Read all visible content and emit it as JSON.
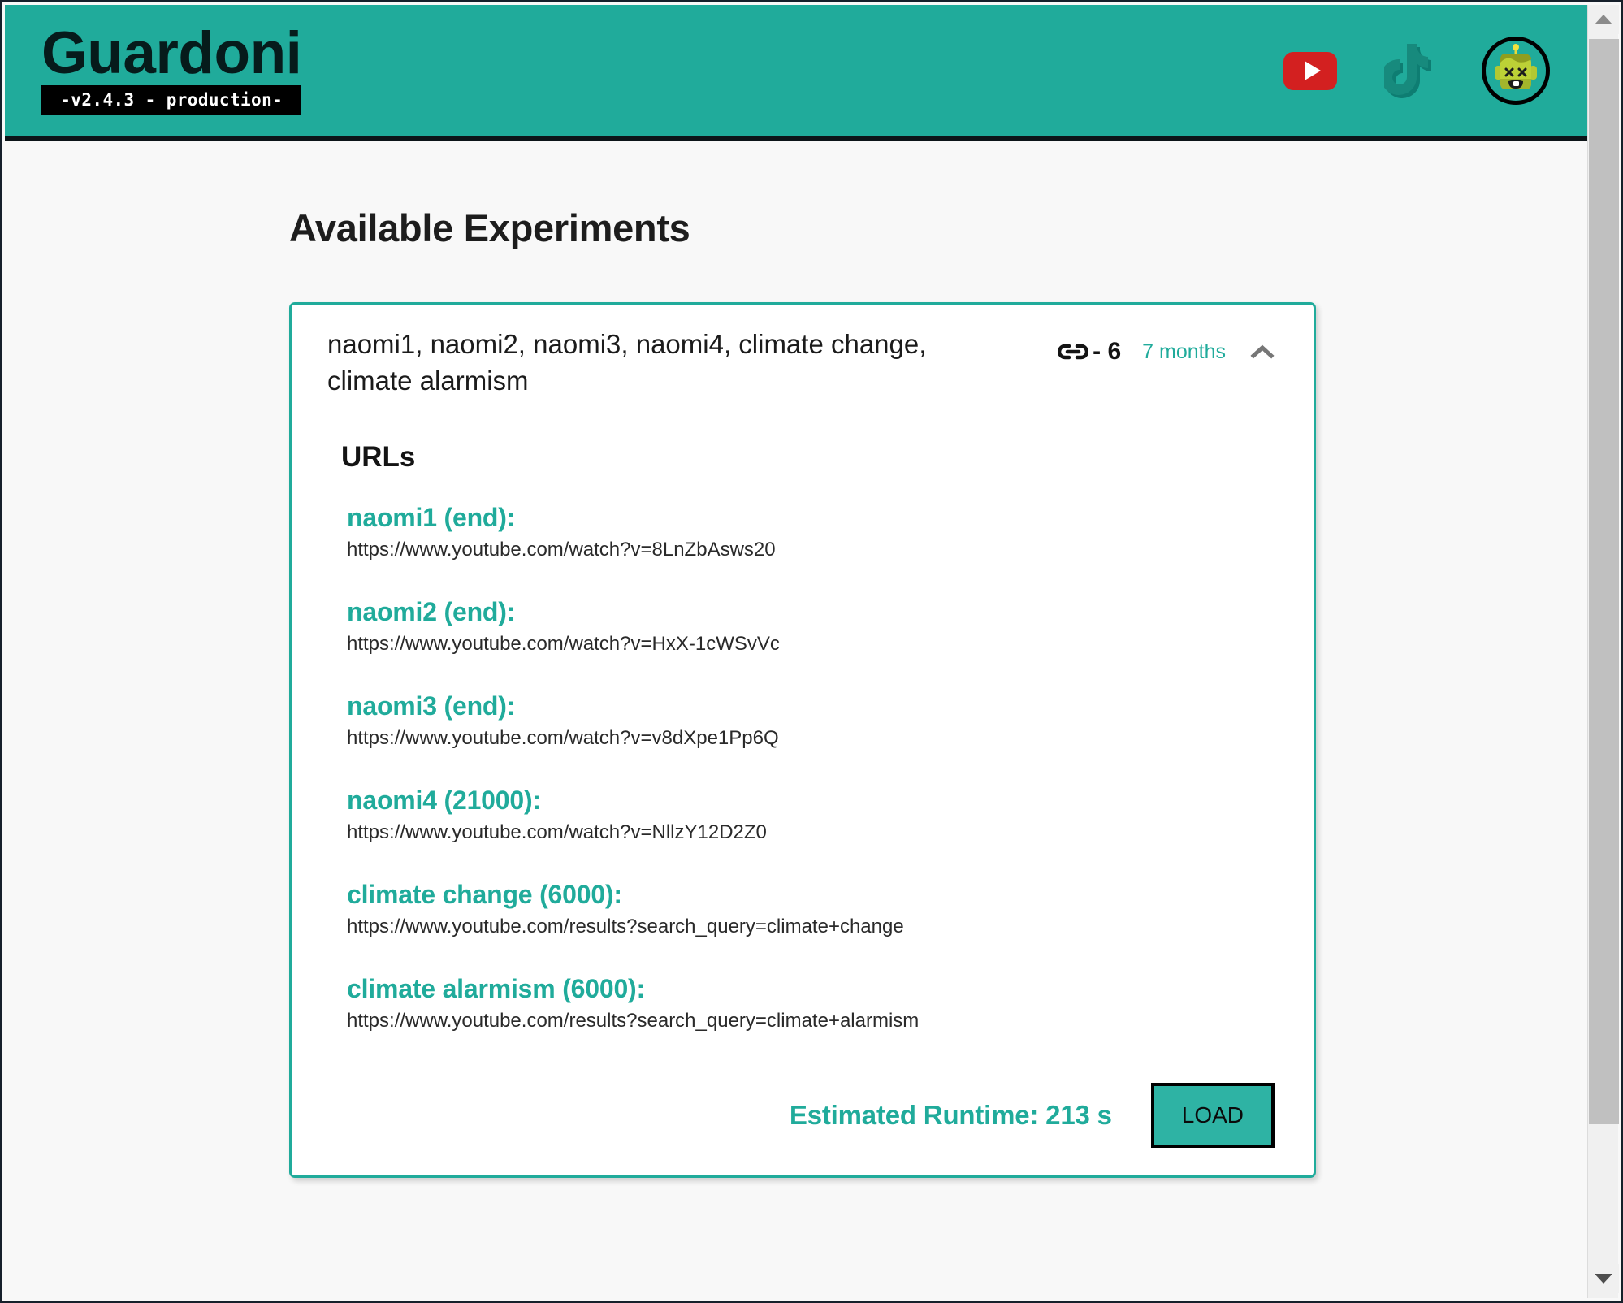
{
  "header": {
    "brand_title": "Guardoni",
    "brand_version": "-v2.4.3 - production-",
    "icons": [
      {
        "name": "youtube-icon",
        "label": "YouTube"
      },
      {
        "name": "tiktok-icon",
        "label": "TikTok"
      },
      {
        "name": "robot-avatar",
        "label": "Guardoni bot avatar"
      }
    ],
    "colors": {
      "teal": "#20ab9b",
      "youtube_red": "#d32020",
      "tiktok_dark": "#178a7d",
      "robot_green": "#b3c832"
    }
  },
  "page": {
    "title": "Available Experiments"
  },
  "experiment": {
    "title": "naomi1, naomi2, naomi3, naomi4, climate change, climate alarmism",
    "links_icon": "link-icon",
    "links_count": "- 6",
    "age": "7 months",
    "collapse_icon": "chevron-up-icon",
    "urls_heading": "URLs",
    "urls": [
      {
        "label": "naomi1 (end):",
        "url": "https://www.youtube.com/watch?v=8LnZbAsws20"
      },
      {
        "label": "naomi2 (end):",
        "url": "https://www.youtube.com/watch?v=HxX-1cWSvVc"
      },
      {
        "label": "naomi3 (end):",
        "url": "https://www.youtube.com/watch?v=v8dXpe1Pp6Q"
      },
      {
        "label": "naomi4 (21000):",
        "url": "https://www.youtube.com/watch?v=NllzY12D2Z0"
      },
      {
        "label": "climate change (6000):",
        "url": "https://www.youtube.com/results?search_query=climate+change"
      },
      {
        "label": "climate alarmism (6000):",
        "url": "https://www.youtube.com/results?search_query=climate+alarmism"
      }
    ],
    "runtime_label": "Estimated Runtime: 213 s",
    "load_button": "LOAD"
  },
  "scrollbar": {
    "up_icon": "scroll-up-arrow-icon",
    "down_icon": "scroll-down-arrow-icon"
  }
}
